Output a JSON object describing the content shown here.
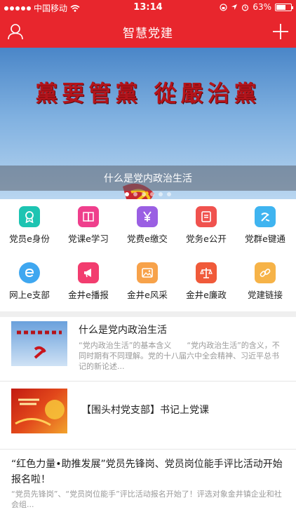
{
  "status_bar": {
    "carrier": "中国移动",
    "time": "13:14",
    "battery": "63%",
    "battery_level": 0.63
  },
  "navbar": {
    "title": "智慧党建",
    "left_icon": "user-icon",
    "right_icon": "plus-icon"
  },
  "banner": {
    "slogan": "黨要管黨 從嚴治黨",
    "caption": "什么是党内政治生活",
    "slide_count": 6,
    "active_slide": 0
  },
  "grid": {
    "items": [
      {
        "label": "党员e身份",
        "icon": "id-badge-icon",
        "color": "#1dc4b2"
      },
      {
        "label": "党课e学习",
        "icon": "book-icon",
        "color": "#ef3f8c"
      },
      {
        "label": "党费e缴交",
        "icon": "yen-icon",
        "color": "#9a5fe3"
      },
      {
        "label": "党务e公开",
        "icon": "document-icon",
        "color": "#f0524e"
      },
      {
        "label": "党群e键通",
        "icon": "party-emblem-icon",
        "color": "#3fb4f0"
      },
      {
        "label": "网上e支部",
        "icon": "e-icon",
        "color": "#3fa7f0"
      },
      {
        "label": "金井e播报",
        "icon": "megaphone-icon",
        "color": "#f23d6f"
      },
      {
        "label": "金井e风采",
        "icon": "photo-icon",
        "color": "#f7a24a"
      },
      {
        "label": "金井e廉政",
        "icon": "scales-icon",
        "color": "#f05a3a"
      },
      {
        "label": "党建链接",
        "icon": "link-icon",
        "color": "#f6b348"
      }
    ]
  },
  "news": [
    {
      "title": "什么是党内政治生活",
      "summary": "“党内政治生活”的基本含义　　“党内政治生活”的含义，不同时期有不同理解。党的十八届六中全会精神、习近平总书记的新论述..."
    },
    {
      "title": "【围头村党支部】书记上党课",
      "summary": ""
    },
    {
      "title": "“红色力量•助推发展”党员先锋岗、党员岗位能手评比活动开始报名啦！",
      "summary": "“党员先锋岗”、“党员岗位能手”评比活动报名开始了！评选对象金井镇企业和社会组..."
    }
  ]
}
